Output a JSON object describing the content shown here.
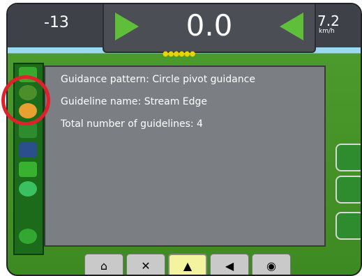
{
  "header": {
    "left_value": "-13",
    "speed_value": "0.0",
    "right_value": "7.2",
    "right_unit": "km/h",
    "page_indicator": "●●●●●●"
  },
  "info_panel": {
    "line1": "Guidance pattern: Circle pivot guidance",
    "line2": "Guideline name: Stream Edge",
    "line3": "Total number of guidelines: 4"
  },
  "sidebar": {
    "icons": [
      "field-icon",
      "pattern-icon",
      "guideline-icon",
      "plant-icon",
      "implement-icon",
      "tilt-icon",
      "drop-icon",
      "link-icon"
    ]
  },
  "bottom_tabs": [
    "home",
    "tools",
    "guidance",
    "map",
    "camera"
  ],
  "colors": {
    "accent_green": "#5fbf3a",
    "highlight_red": "#e0202a"
  }
}
